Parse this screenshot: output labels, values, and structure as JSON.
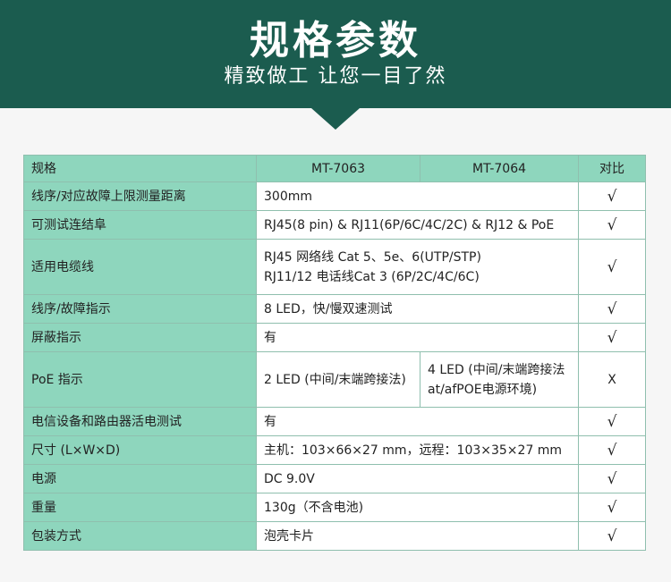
{
  "header": {
    "title": "规格参数",
    "subtitle": "精致做工 让您一目了然"
  },
  "table": {
    "columns": [
      "规格",
      "MT-7063",
      "MT-7064",
      "对比"
    ],
    "rows": [
      {
        "label": "线序/对应故障上限测量距离",
        "value": "300mm",
        "mark": "√"
      },
      {
        "label": "可测试连结阜",
        "value": "RJ45(8 pin) & RJ11(6P/6C/4C/2C) & RJ12 & PoE",
        "mark": "√"
      },
      {
        "label": "适用电缆线",
        "value_line1": "RJ45 网络线 Cat 5、5e、6(UTP/STP)",
        "value_line2": "RJ11/12 电话线Cat 3 (6P/2C/4C/6C)",
        "mark": "√"
      },
      {
        "label": "线序/故障指示",
        "value": "8 LED，快/慢双速测试",
        "mark": "√"
      },
      {
        "label": "屏蔽指示",
        "value": "有",
        "mark": "√"
      },
      {
        "label": "PoE 指示",
        "value_a": "2 LED (中间/末端跨接法)",
        "value_b_line1": "4 LED (中间/末端跨接法",
        "value_b_line2": "at/afPOE电源环境)",
        "mark": "X"
      },
      {
        "label": "电信设备和路由器活电测试",
        "value": "有",
        "mark": "√"
      },
      {
        "label": "尺寸 (L×W×D)",
        "value": "主机：103×66×27 mm，远程：103×35×27 mm",
        "mark": "√"
      },
      {
        "label": "电源",
        "value": "DC 9.0V",
        "mark": "√"
      },
      {
        "label": "重量",
        "value": "130g（不含电池)",
        "mark": "√"
      },
      {
        "label": "包装方式",
        "value": "泡壳卡片",
        "mark": "√"
      }
    ]
  },
  "colors": {
    "banner": "#1b5c4f",
    "label_cell": "#8ed6bd",
    "background": "#f6f6f6"
  }
}
